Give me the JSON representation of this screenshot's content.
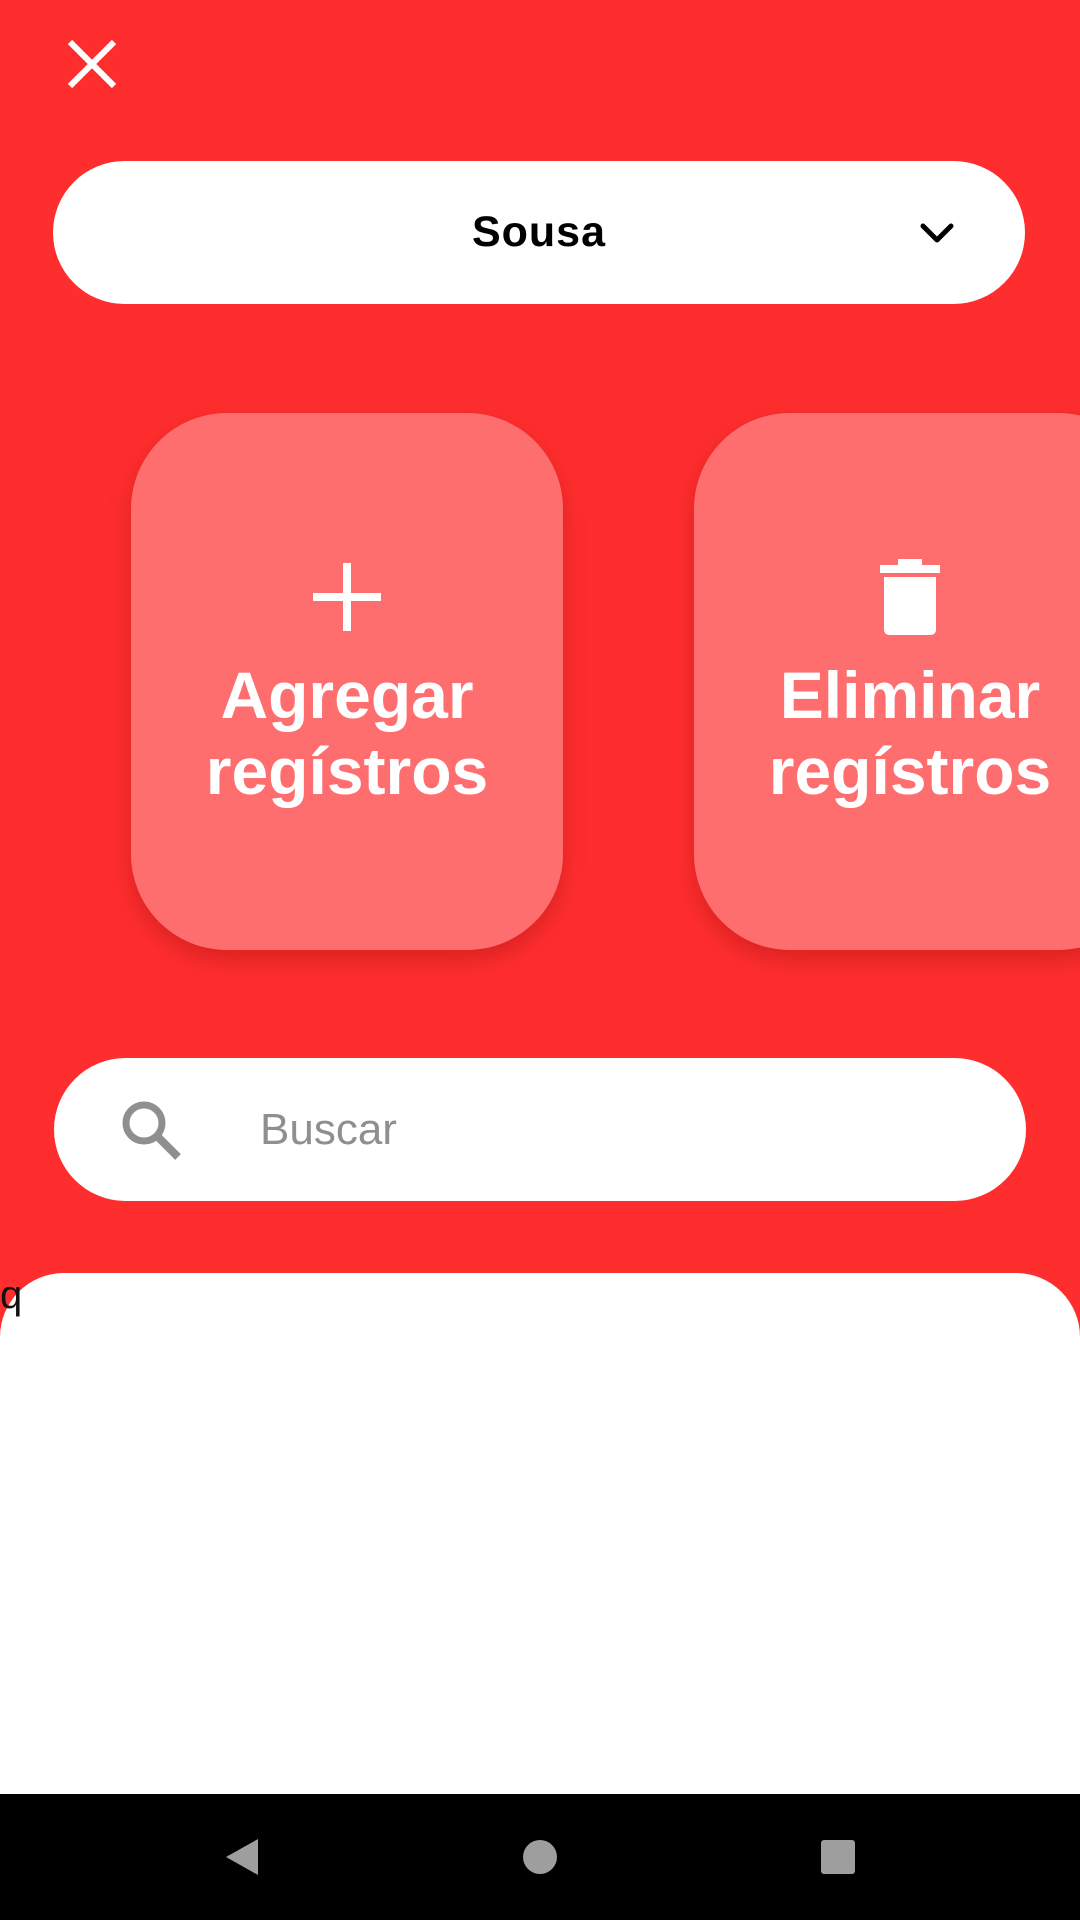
{
  "colors": {
    "background": "#FF2E2E",
    "card": "#FF6E6E",
    "surface": "#FFFFFF",
    "placeholder": "#8F8F8F",
    "nav_bar": "#000000",
    "nav_icons": "#9E9E9E"
  },
  "header": {
    "close_icon": "close-icon"
  },
  "selector": {
    "value": "Sousa",
    "chevron_icon": "chevron-down-icon"
  },
  "actions": [
    {
      "icon": "plus-icon",
      "label": "Agregar\nregístros"
    },
    {
      "icon": "trash-icon",
      "label": "Eliminar\nregístros"
    }
  ],
  "search": {
    "icon": "search-icon",
    "placeholder": "Buscar",
    "value": ""
  },
  "list": {
    "items": [
      "q"
    ]
  },
  "nav": {
    "back_icon": "back-icon",
    "home_icon": "home-icon",
    "recents_icon": "recents-icon"
  }
}
